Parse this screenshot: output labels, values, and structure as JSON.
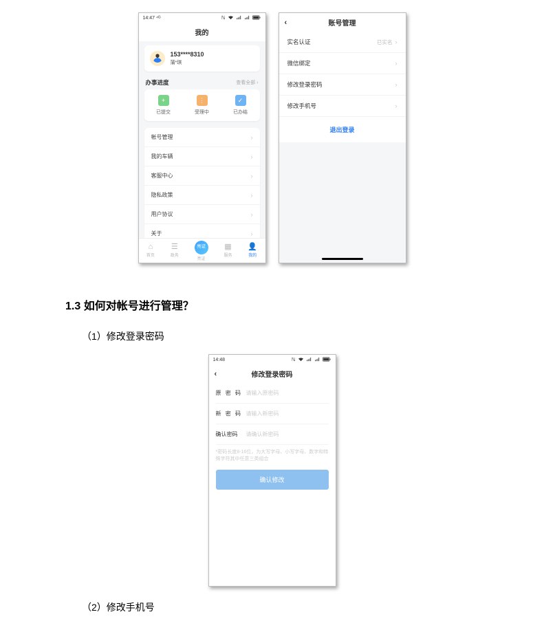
{
  "status": {
    "time": "14:47",
    "sigText": "⁴ᴳ"
  },
  "statusC": {
    "time": "14:48"
  },
  "phoneA": {
    "title": "我的",
    "user": {
      "phone": "153****8310",
      "name": "蒲*琪"
    },
    "progress": {
      "title": "办事进度",
      "more": "查看全部 ›"
    },
    "tiles": [
      {
        "icon": "+",
        "color": "#7bd389",
        "label": "已提交"
      },
      {
        "icon": "⋮",
        "color": "#f6b26b",
        "label": "受理中"
      },
      {
        "icon": "✓",
        "color": "#6fb3f2",
        "label": "已办结"
      }
    ],
    "menu": [
      "帐号管理",
      "我的车辆",
      "客服中心",
      "隐私政策",
      "用户协议",
      "关于"
    ],
    "tabs": [
      "首页",
      "政务",
      "亮证",
      "服务",
      "我的"
    ],
    "tabCenter": "亮证"
  },
  "phoneB": {
    "title": "账号管理",
    "rows": [
      {
        "label": "实名认证",
        "sub": "已实名"
      },
      {
        "label": "微信绑定",
        "sub": ""
      },
      {
        "label": "修改登录密码",
        "sub": ""
      },
      {
        "label": "修改手机号",
        "sub": ""
      }
    ],
    "logout": "退出登录"
  },
  "doc": {
    "h13": "1.3 如何对帐号进行管理？",
    "step1": "（1）修改登录密码",
    "step2": "（2）修改手机号"
  },
  "phoneC": {
    "title": "修改登录密码",
    "fields": [
      {
        "label": "原 密 码",
        "ph": "请输入原密码"
      },
      {
        "label": "新 密 码",
        "ph": "请输入新密码"
      },
      {
        "label": "确认密码",
        "ph": "请确认新密码",
        "tight": true
      }
    ],
    "hint": "*密码长度8-16位，为大写字母、小写字母、数字和特殊字符其中任意三类组合",
    "btn": "确认修改"
  }
}
